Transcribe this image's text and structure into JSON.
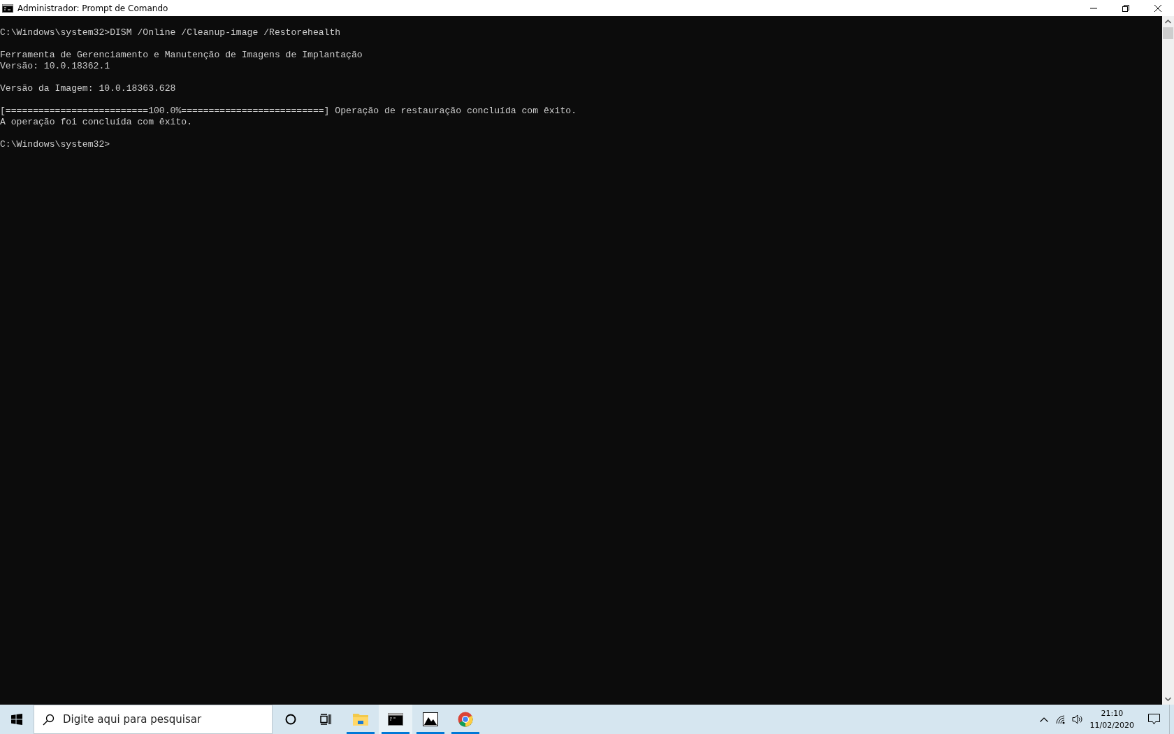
{
  "window": {
    "title": "Administrador: Prompt de Comando"
  },
  "console": {
    "blocks": [
      [
        "C:\\Windows\\system32>DISM /Online /Cleanup-image /Restorehealth"
      ],
      [
        "Ferramenta de Gerenciamento e Manutenção de Imagens de Implantação",
        "Versão: 10.0.18362.1"
      ],
      [
        "Versão da Imagem: 10.0.18363.628"
      ],
      [
        "[==========================100.0%==========================] Operação de restauração concluída com êxito.",
        "A operação foi concluída com êxito."
      ],
      [
        "C:\\Windows\\system32>"
      ]
    ]
  },
  "taskbar": {
    "search": {
      "placeholder": "Digite aqui para pesquisar"
    },
    "apps": [
      {
        "kind": "explorer",
        "running": true,
        "selected": false
      },
      {
        "kind": "terminal",
        "running": true,
        "selected": true
      },
      {
        "kind": "photos",
        "running": true,
        "selected": false
      },
      {
        "kind": "browser",
        "running": true,
        "selected": false
      }
    ],
    "clock": {
      "time": "21:10",
      "date": "11/02/2020"
    }
  }
}
